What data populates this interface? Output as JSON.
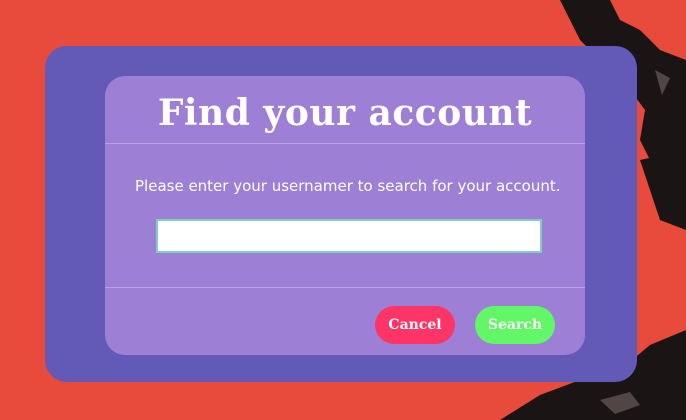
{
  "dialog": {
    "title": "Find your account",
    "instruction": "Please enter your usernamer to search for your account.",
    "username_value": "",
    "username_placeholder": "",
    "cancel_label": "Cancel",
    "search_label": "Search"
  },
  "colors": {
    "page_background": "#e84a3c",
    "outer_card": "#635ab8",
    "inner_card": "#9d7fd6",
    "cancel_button": "#ff3567",
    "search_button": "#61f766"
  }
}
